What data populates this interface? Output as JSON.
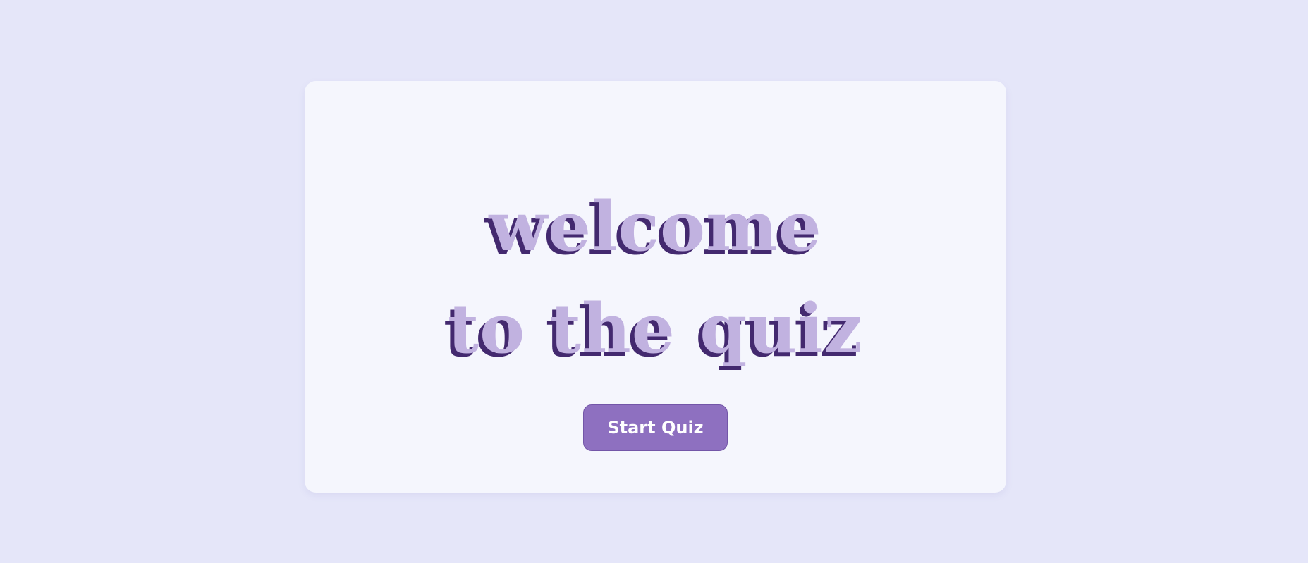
{
  "welcome": {
    "title_line_1": "welcome",
    "title_line_2": "to the quiz",
    "start_button_label": "Start Quiz"
  },
  "colors": {
    "background": "#e5e6f9",
    "card": "#f5f6fd",
    "title_fill": "#c1b2e0",
    "title_shadow": "#43296f",
    "button": "#8e70c0",
    "button_text": "#ffffff"
  }
}
